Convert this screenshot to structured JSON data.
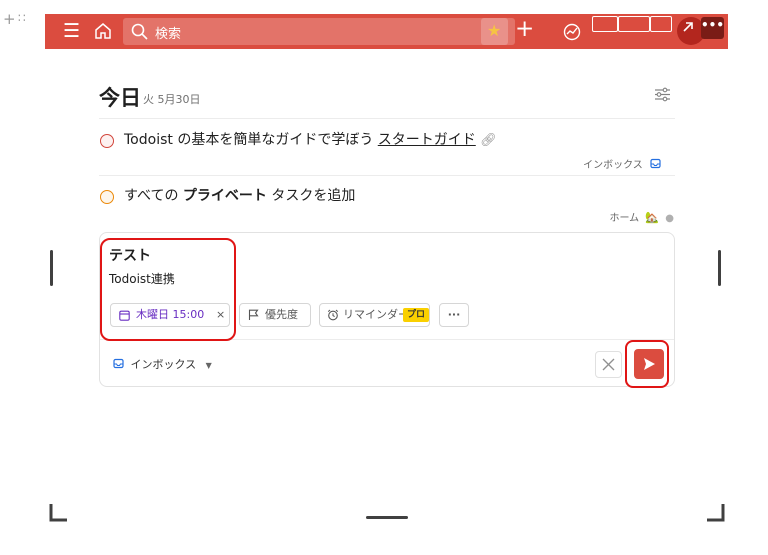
{
  "topbar": {
    "menu_icon": "menu-icon",
    "home_icon": "home-icon",
    "search_placeholder": "検索",
    "search_icon": "search-icon"
  },
  "page": {
    "title": "今日",
    "date": "火 5月30日",
    "view_options_icon": "sliders-icon"
  },
  "tasks": [
    {
      "text_prefix": "Todoist の基本を簡単なガイドで学ぼう ",
      "link_text": "スタートガイド",
      "priority_color": "#d1453b",
      "project": "インボックス",
      "project_icon": "inbox-icon"
    },
    {
      "text_prefix": "すべての ",
      "bold_text": "プライベート",
      "text_suffix": " タスクを追加",
      "priority_color": "#eb8909",
      "project": "ホーム",
      "project_icon": "house-emoji"
    }
  ],
  "editor": {
    "task_name": "テスト",
    "description": "Todoist連携",
    "due_chip": "木曜日 15:00",
    "due_color": "#692ec2",
    "priority_chip": "優先度",
    "reminder_chip": "リマインダー",
    "pro_badge": "プロ",
    "project_select": "インボックス",
    "accent_color": "#db4c3f"
  }
}
